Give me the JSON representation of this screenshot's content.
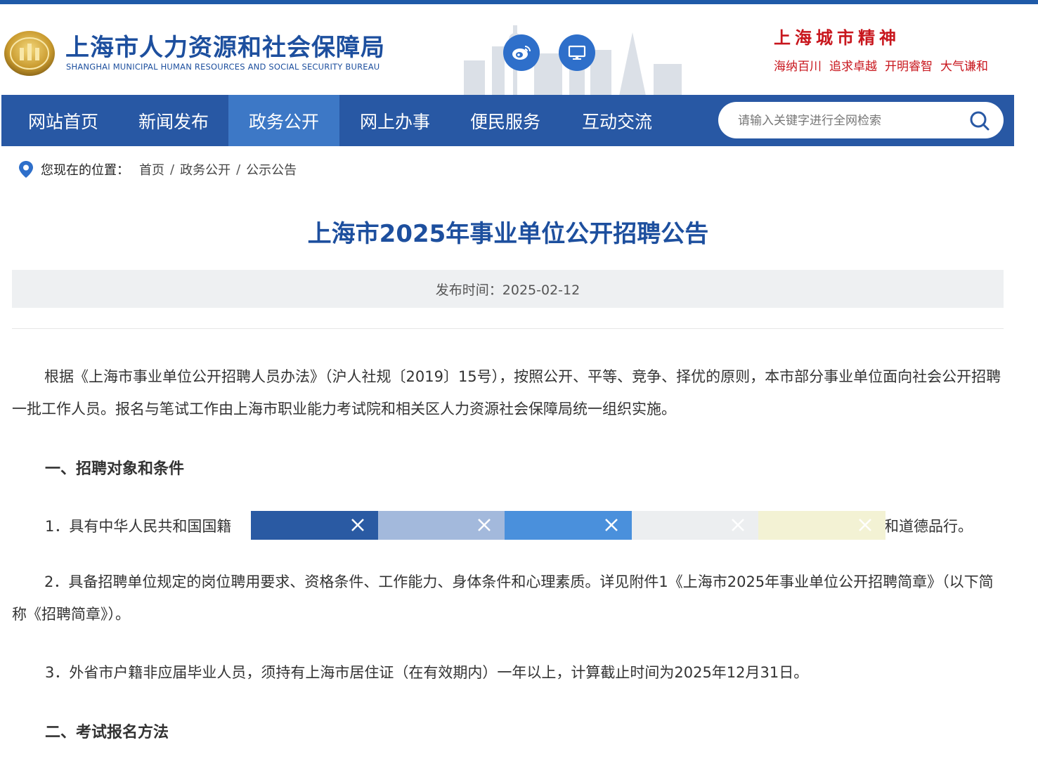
{
  "header": {
    "org_name_cn": "上海市人力资源和社会保障局",
    "org_name_en": "SHANGHAI MUNICIPAL HUMAN RESOURCES AND SOCIAL SECURITY BUREAU",
    "weibo_icon": "weibo-icon",
    "monitor_icon": "monitor-icon",
    "spirit_title": "上海城市精神",
    "spirit_words": [
      "海纳百川",
      "追求卓越",
      "开明睿智",
      "大气谦和"
    ]
  },
  "nav": {
    "items": [
      {
        "label": "网站首页"
      },
      {
        "label": "新闻发布"
      },
      {
        "label": "政务公开",
        "active": true
      },
      {
        "label": "网上办事"
      },
      {
        "label": "便民服务"
      },
      {
        "label": "互动交流"
      }
    ],
    "search_placeholder": "请输入关键字进行全网检索"
  },
  "breadcrumb": {
    "label": "您现在的位置：",
    "items": [
      "首页",
      "政务公开",
      "公示公告"
    ]
  },
  "article": {
    "title": "上海市2025年事业单位公开招聘公告",
    "publish_time": "发布时间：2025-02-12",
    "intro": "根据《上海市事业单位公开招聘人员办法》（沪人社规〔2019〕15号），按照公开、平等、竞争、择优的原则，本市部分事业单位面向社会公开招聘一批工作人员。报名与笔试工作由上海市职业能力考试院和相关区人力资源社会保障局统一组织实施。",
    "section1_heading": "一、招聘对象和条件",
    "item1_start": "1．具有中华人民共和国国籍",
    "item1_end": "和道德品行。",
    "item2": "2．具备招聘单位规定的岗位聘用要求、资格条件、工作能力、身体条件和心理素质。详见附件1《上海市2025年事业单位公开招聘简章》（以下简称《招聘简章》）。",
    "item3": "3．外省市户籍非应届毕业人员，须持有上海市居住证（在有效期内）一年以上，计算截止时间为2025年12月31日。",
    "section2_heading": "二、考试报名方法"
  },
  "color_strip": {
    "colors": [
      "#2a5aa3",
      "#a3b9dc",
      "#4a90dc",
      "#eceef0",
      "#f3f2d4"
    ]
  }
}
